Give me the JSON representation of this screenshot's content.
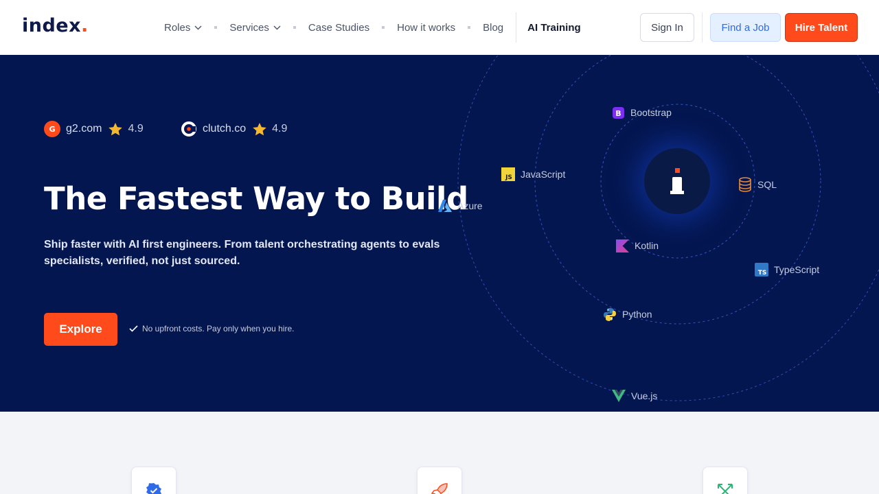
{
  "header": {
    "logo_text": "index",
    "logo_dot": ".",
    "nav": {
      "roles": "Roles",
      "services": "Services",
      "case_studies": "Case Studies",
      "how_it_works": "How it works",
      "blog": "Blog",
      "ai_training": "AI Training"
    },
    "sign_in": "Sign In",
    "find_job": "Find a Job",
    "hire_talent": "Hire Talent"
  },
  "hero": {
    "ratings": [
      {
        "site": "g2.com",
        "score": "4.9"
      },
      {
        "site": "clutch.co",
        "score": "4.9"
      }
    ],
    "title": "The Fastest Way to Build",
    "subtitle": "Ship faster with AI first engineers. From talent orchestrating agents to evals specialists, verified, not just sourced.",
    "cta": "Explore",
    "note": "No upfront costs. Pay only when you hire."
  },
  "technologies": {
    "bootstrap": "Bootstrap",
    "javascript": "JavaScript",
    "azure": "Azure",
    "sql": "SQL",
    "kotlin": "Kotlin",
    "typescript": "TypeScript",
    "python": "Python",
    "vue": "Vue.js"
  },
  "colors": {
    "brand_orange": "#ff4a1c",
    "hero_navy": "#041650",
    "find_job_bg": "#e4efff",
    "star": "#f5b82e"
  },
  "icons": {
    "features": [
      "verified-badge-icon",
      "rocket-icon",
      "cross-arrows-icon"
    ]
  }
}
